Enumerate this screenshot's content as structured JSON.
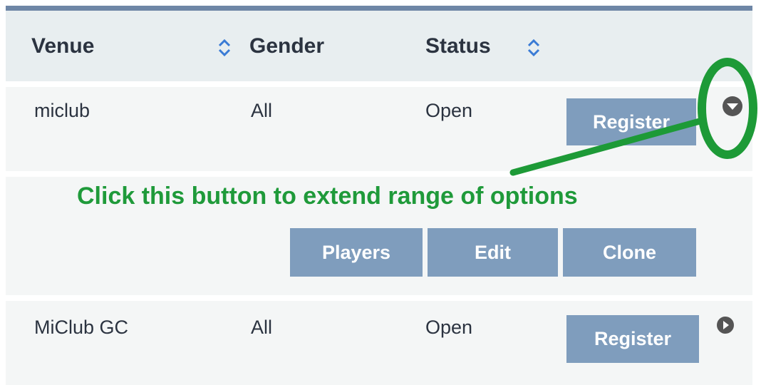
{
  "table": {
    "headers": {
      "venue": "Venue",
      "gender": "Gender",
      "status": "Status"
    },
    "rows": [
      {
        "venue": "miclub",
        "gender": "All",
        "status": "Open",
        "register_label": "Register",
        "expanded": true,
        "actions": [
          "Players",
          "Edit",
          "Clone"
        ]
      },
      {
        "venue": "MiClub GC",
        "gender": "All",
        "status": "Open",
        "register_label": "Register",
        "expanded": false
      }
    ]
  },
  "annotation": {
    "text": "Click this button to extend range of options",
    "color": "#1f9a3a"
  },
  "colors": {
    "button_bg": "#7f9dbd",
    "header_border": "#6e86a6",
    "sort_icon": "#3a7bd5"
  },
  "icons": {
    "sort": "sort-updown-icon",
    "expanded_toggle": "chevron-down-circle-icon",
    "collapsed_toggle": "chevron-right-circle-icon"
  }
}
